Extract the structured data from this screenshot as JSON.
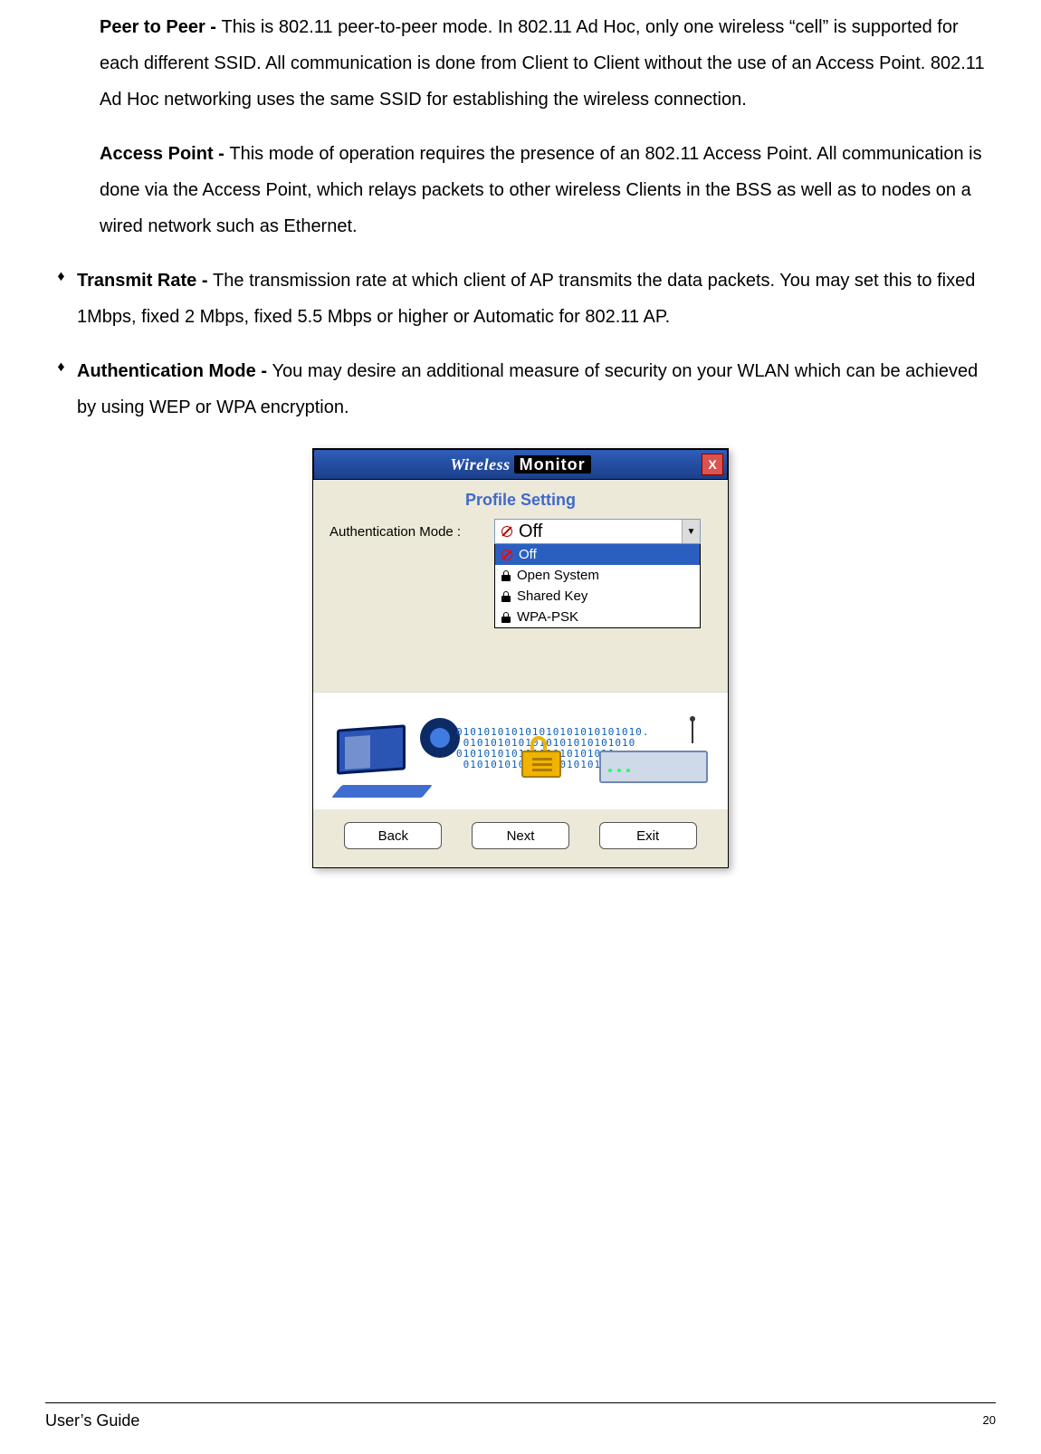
{
  "paragraphs": {
    "peer_label": "Peer to Peer",
    "peer_sep": " - ",
    "peer_text": "This is 802.11 peer-to-peer mode. In 802.11 Ad Hoc, only one wireless “cell” is supported for each different SSID. All communication is done from Client to Client without the use of an Access Point. 802.11 Ad Hoc networking uses the same SSID for establishing the wireless connection.",
    "ap_label": "Access Point",
    "ap_sep": " - ",
    "ap_text": "This mode of operation requires the presence of an 802.11 Access Point. All communication is done via the Access Point, which relays packets to other wireless Clients in the BSS as well as to nodes on a wired network such as Ethernet."
  },
  "bullets": {
    "marker": "♦",
    "transmit_label": "Transmit Rate - ",
    "transmit_text": "The transmission rate at which client of AP transmits the data packets. You may set this to fixed 1Mbps, fixed 2 Mbps, fixed 5.5 Mbps or higher or Automatic for 802.11 AP.",
    "auth_label": "Authentication Mode - ",
    "auth_text": "You may desire an additional measure of security on your WLAN which can be achieved by using WEP or WPA encryption."
  },
  "dialog": {
    "title_wireless": "Wireless",
    "title_monitor": "Monitor",
    "close": "X",
    "subtitle": "Profile Setting",
    "form_label": "Authentication Mode :",
    "selected": "Off",
    "arrow": "▼",
    "options": {
      "off": "Off",
      "open": "Open System",
      "shared": "Shared Key",
      "wpa": "WPA-PSK"
    },
    "buttons": {
      "back": "Back",
      "next": "Next",
      "exit": "Exit"
    }
  },
  "binary_art": "010101010101010101010101010.\n 0101010101010101010101010\n01010101010101010101010\n 01010101010101010101010",
  "footer": {
    "guide": "User’s Guide",
    "page": "20"
  }
}
